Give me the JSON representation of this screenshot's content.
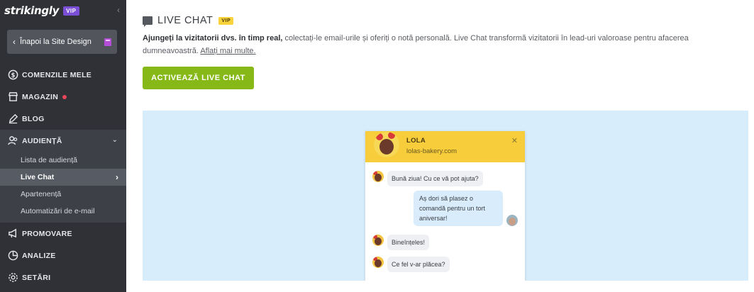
{
  "brand": {
    "logo": "strikingly",
    "vip": "VIP"
  },
  "sidebar": {
    "back_label": "Înapoi la Site Design",
    "nav": [
      {
        "key": "orders",
        "label": "COMENZILE MELE",
        "icon": "dollar-circle-icon"
      },
      {
        "key": "store",
        "label": "MAGAZIN",
        "icon": "store-icon",
        "dot": true
      },
      {
        "key": "blog",
        "label": "BLOG",
        "icon": "pen-icon"
      },
      {
        "key": "audience",
        "label": "AUDIENȚĂ",
        "icon": "users-icon",
        "expanded": true
      },
      {
        "key": "promo",
        "label": "PROMOVARE",
        "icon": "megaphone-icon"
      },
      {
        "key": "analytics",
        "label": "ANALIZE",
        "icon": "pie-chart-icon"
      },
      {
        "key": "settings",
        "label": "SETĂRI",
        "icon": "gear-icon"
      }
    ],
    "subnav": [
      {
        "label": "Lista de audiență"
      },
      {
        "label": "Live Chat",
        "active": true
      },
      {
        "label": "Apartenență"
      },
      {
        "label": "Automatizări de e-mail"
      }
    ]
  },
  "main": {
    "title": "LIVE CHAT",
    "vip": "VIP",
    "desc_bold": "Ajungeți la vizitatorii dvs. în timp real,",
    "desc_text": " colectați-le email-urile și oferiți o notă personală. Live Chat transformă vizitatorii în lead-uri valoroase pentru afacerea dumneavoastră. ",
    "desc_link": "Aflați mai multe.",
    "cta": "ACTIVEAZĂ LIVE CHAT"
  },
  "widget": {
    "name": "LOLA",
    "url": "lolas-bakery.com",
    "messages": [
      {
        "from": "agent",
        "text": "Bună ziua! Cu ce vă pot ajuta?"
      },
      {
        "from": "user",
        "text": "Aș dori să plasez o comandă pentru un tort aniversar!"
      },
      {
        "from": "agent",
        "text": "Bineînțeles!"
      },
      {
        "from": "agent",
        "text": "Ce fel v-ar plăcea?"
      }
    ]
  },
  "colors": {
    "sidebar_bg": "#2f3136",
    "cta_green": "#86b817",
    "preview_bg": "#d8edfc",
    "widget_header": "#f8cd3b",
    "vip_purple": "#7a4fd6",
    "vip_yellow": "#f8d33b"
  }
}
